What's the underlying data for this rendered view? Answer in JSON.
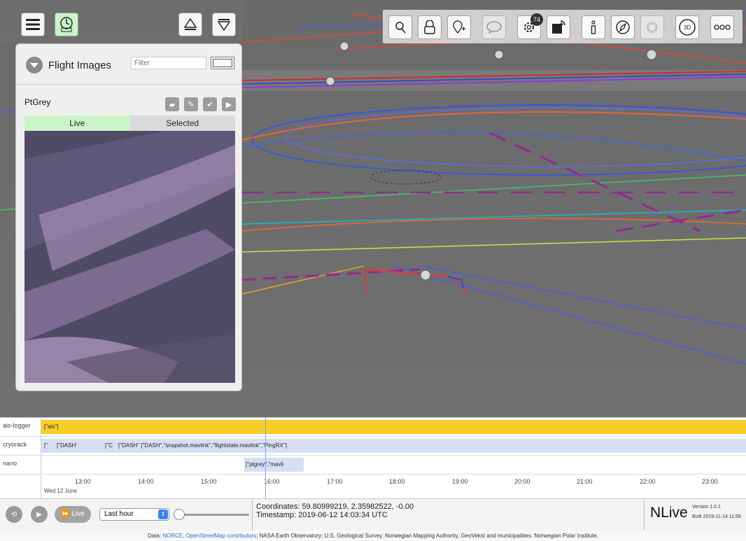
{
  "panel": {
    "title": "Flight Images",
    "filter_placeholder": "Filter",
    "camera": "PtGrey",
    "tabs": [
      "Live",
      "Selected"
    ]
  },
  "toolbar": {
    "left": [
      "menu-icon",
      "flight-replay-icon",
      "collapse-up-icon",
      "expand-down-icon"
    ],
    "right": [
      "search-icon",
      "lock-icon",
      "add-marker-icon",
      "comment-icon",
      "settings-icon",
      "layer-icon",
      "info-icon",
      "compass-icon",
      "sun-icon",
      "3d-icon",
      "more-icon"
    ],
    "settings_badge": "74",
    "view_mode_label": "3D"
  },
  "timeline": {
    "tracks": [
      {
        "label": "ais-logger",
        "segments": [
          "[\"ais\"]"
        ]
      },
      {
        "label": "cryorack",
        "segments": [
          "[\"",
          "[\"DASH'",
          "[\"C",
          "[\"DASH\" [\"DASH\",\"snapshot.mavlink\",\"flightstate.mavlink\",\"PingRX\"]"
        ]
      },
      {
        "label": "nano",
        "segments": [
          "[\"ptgrey\",\"mavli"
        ]
      }
    ],
    "hours": [
      "13:00",
      "14:00",
      "15:00",
      "16:00",
      "17:00",
      "18:00",
      "19:00",
      "20:00",
      "21:00",
      "22:00",
      "23:00"
    ],
    "date": "Wed 12 June"
  },
  "controls": {
    "live_label": "Live",
    "range_value": "Last hour"
  },
  "status": {
    "coordinates_label": "Coordinates:",
    "coordinates_value": "59.80999219, 2.35982522, -0.00",
    "timestamp_label": "Timestamp:",
    "timestamp_value": "2019-06-12 14:03:34 UTC"
  },
  "brand": {
    "name": "NLive",
    "version": "Version 1.0.1",
    "built": "Built 2019-11-14 11:58"
  },
  "attribution": {
    "prefix": "Data: ",
    "link1": "NORCE",
    "sep": ", ",
    "link2": "OpenStreetMap contributors",
    "rest": "; NASA Earth Observatory; U.S. Geological Survey. Norwegian Mapping Authority, GeoVekst and municipalities. Norwegian Polar Institute."
  },
  "colors": {
    "ais_bar": "#f7cd2a",
    "cryorack_bar": "#d8def4",
    "live_tab": "#c9f5c9",
    "accent_blue": "#3a82f7"
  }
}
